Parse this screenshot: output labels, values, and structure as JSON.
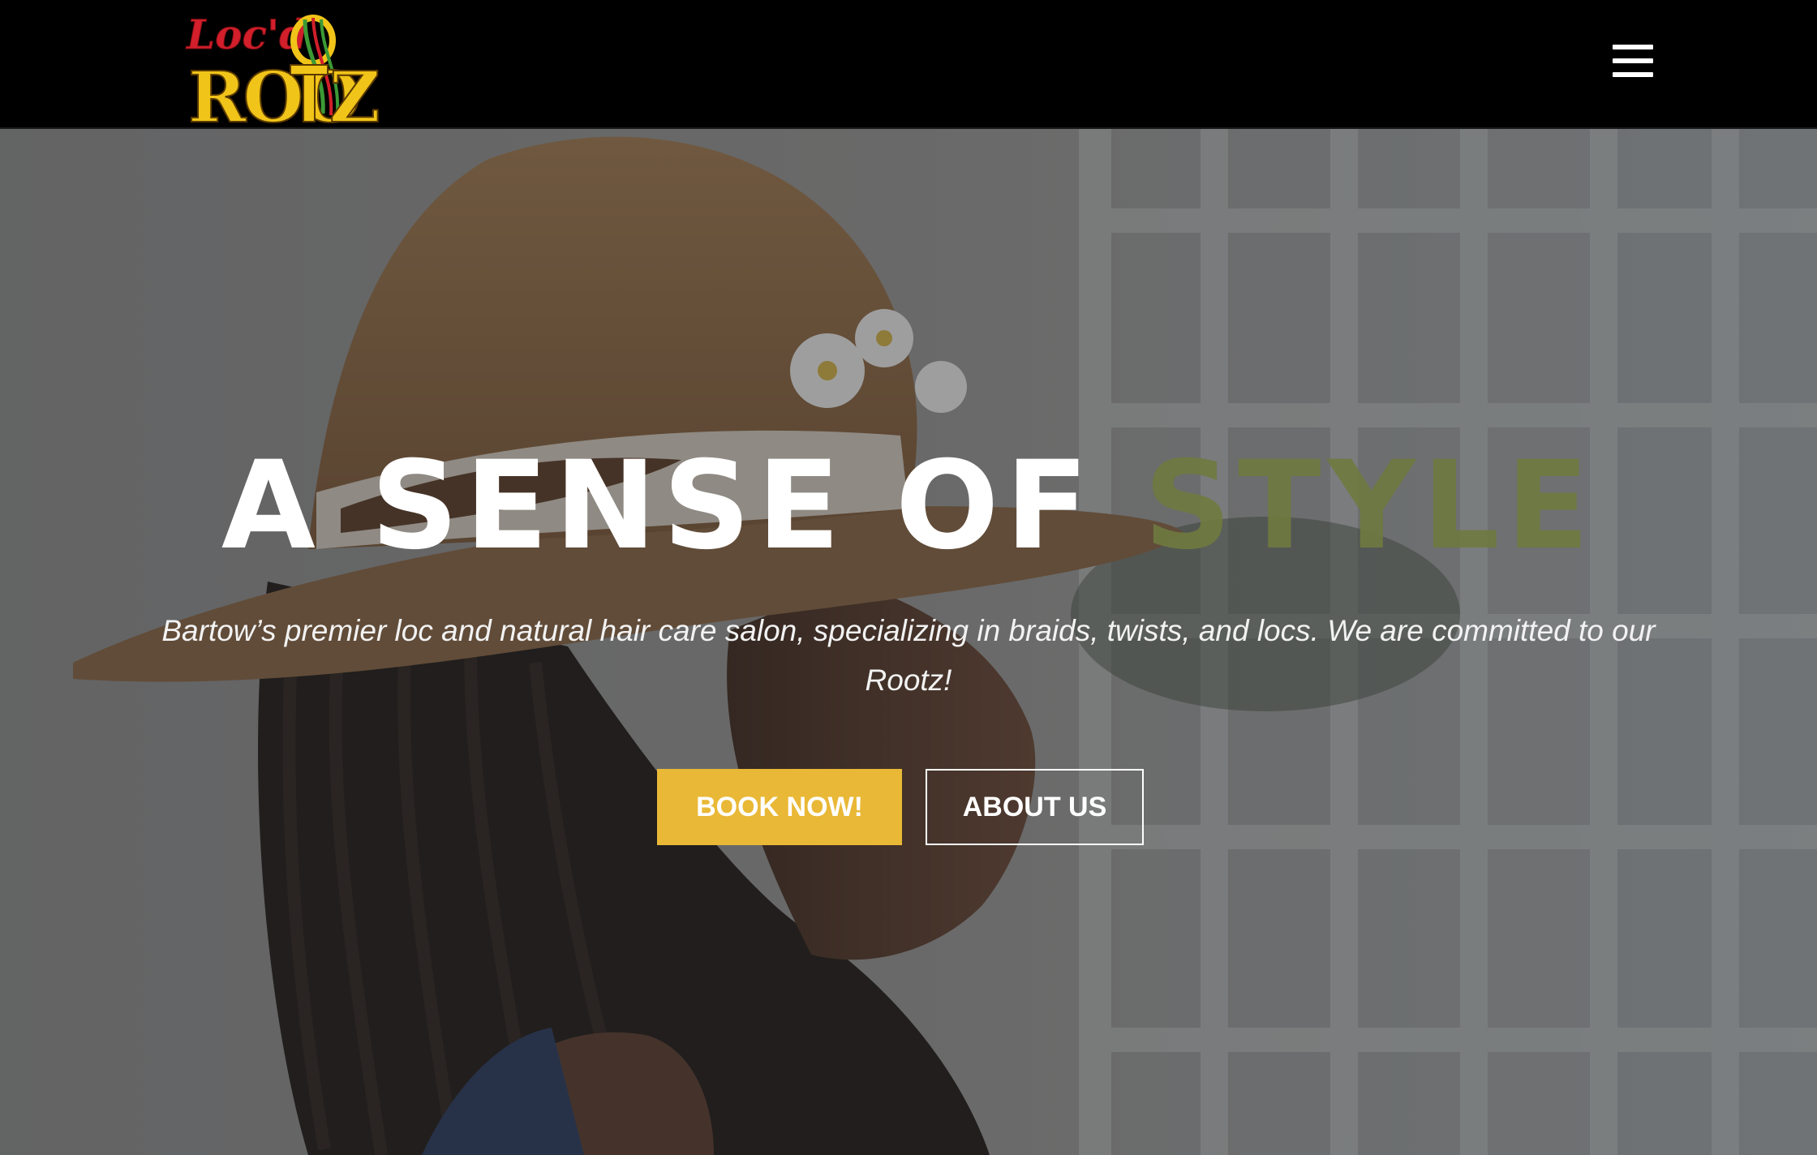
{
  "header": {
    "logo": {
      "script_text": "Loc'd",
      "wordmark": "ROOTZ"
    },
    "menu_icon": "hamburger-menu-icon"
  },
  "hero": {
    "headline_part1": "A SENSE OF",
    "headline_part2": "STYLE",
    "subtitle": "Bartow’s premier loc and natural hair care salon, specializing in braids, twists, and locs. We are committed to our Rootz!",
    "buttons": {
      "book_label": "BOOK NOW!",
      "about_label": "ABOUT US"
    }
  },
  "colors": {
    "topbar_bg": "#000000",
    "book_button_bg": "#e9b836",
    "headline_accent": "#6f7a40",
    "logo_red": "#d21f2b",
    "logo_gold": "#f0c419",
    "logo_green": "#3c9a35"
  }
}
